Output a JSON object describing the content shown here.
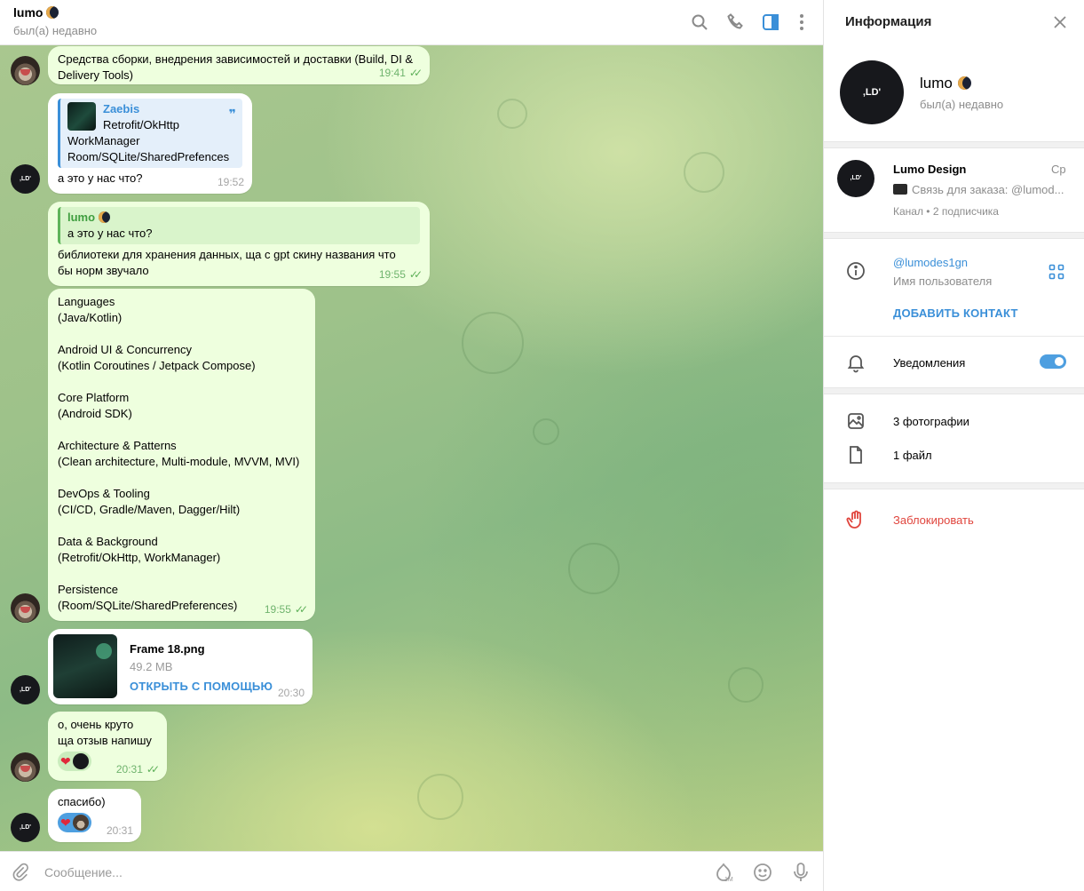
{
  "chat": {
    "title": "lumo",
    "status": "был(а) недавно",
    "header_icons": [
      "search-icon",
      "phone-icon",
      "sidebar-toggle-icon",
      "more-vertical-icon"
    ]
  },
  "messages": [
    {
      "direction": "out",
      "text": "Средства сборки, внедрения зависимостей и доставки (Build, DI &\nDelivery Tools)",
      "time": "19:41",
      "read": true
    },
    {
      "direction": "in",
      "quote": {
        "name": "Zaebis",
        "text": "Retrofit/OkHttp\nWorkManager\nRoom/SQLite/SharedPrefences"
      },
      "text": "а это у нас что?",
      "time": "19:52"
    },
    {
      "direction": "out",
      "quote": {
        "name": "lumo",
        "text": "а это у нас что?"
      },
      "text": "библиотеки для хранения данных, ща с gpt скину названия что\nбы норм звучало",
      "time": "19:55",
      "read": true
    },
    {
      "direction": "out",
      "text": "Languages\n(Java/Kotlin)\n\nAndroid UI & Concurrency\n(Kotlin Coroutines / Jetpack Compose)\n\nCore Platform\n(Android SDK)\n\nArchitecture & Patterns\n(Clean architecture, Multi-module, MVVM, MVI)\n\nDevOps & Tooling\n(CI/CD, Gradle/Maven, Dagger/Hilt)\n\nData & Background\n(Retrofit/OkHttp, WorkManager)\n\nPersistence\n(Room/SQLite/SharedPreferences)",
      "time": "19:55",
      "read": true
    },
    {
      "direction": "in",
      "file": {
        "name": "Frame 18.png",
        "size": "49.2 MB",
        "action": "ОТКРЫТЬ С ПОМОЩЬЮ"
      },
      "time": "20:30"
    },
    {
      "direction": "out",
      "text": "о, очень круто\nща отзыв напишу",
      "time": "20:31",
      "read": true,
      "reactions": [
        "heart"
      ]
    },
    {
      "direction": "in",
      "text": "спасибо)",
      "time": "20:31",
      "reactions": [
        "heart"
      ]
    }
  ],
  "composer": {
    "placeholder": "Сообщение..."
  },
  "info": {
    "title": "Информация",
    "profile": {
      "name": "lumo",
      "status": "был(а) недавно",
      "avatar_text": ",LD'"
    },
    "channel": {
      "name": "Lumo Design",
      "date": "Ср",
      "preview": "Связь для заказа: @lumod...",
      "meta": "Канал • 2 подписчика"
    },
    "username": {
      "value": "@lumodes1gn",
      "label": "Имя пользователя",
      "add_contact": "ДОБАВИТЬ КОНТАКТ"
    },
    "notifications": {
      "label": "Уведомления",
      "enabled": true
    },
    "media": {
      "photos": "3 фотографии",
      "files": "1 файл"
    },
    "block": {
      "label": "Заблокировать",
      "color": "#e0453d"
    }
  },
  "colors": {
    "accent": "#3a8fd8",
    "bubble_out": "#eeffde",
    "bubble_in": "#ffffff",
    "tick": "#5fb15a"
  }
}
